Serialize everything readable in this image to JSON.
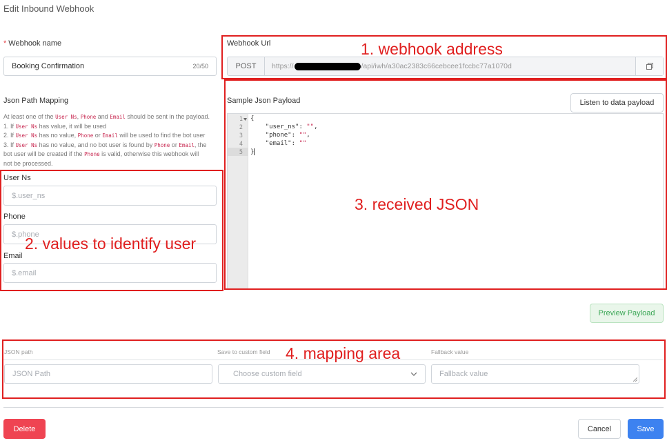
{
  "page": {
    "title": "Edit Inbound Webhook"
  },
  "webhook_name": {
    "label": "Webhook name",
    "required_mark": "*",
    "value": "Booking Confirmation",
    "counter": "20/50"
  },
  "webhook_url": {
    "label": "Webhook Url",
    "method": "POST",
    "url_prefix": "https://",
    "url_suffix": "/api/iwh/a30ac2383c66cebcee1fccbc77a1070d",
    "copy_icon": "copy-icon"
  },
  "json_path_mapping": {
    "title": "Json Path Mapping",
    "help": {
      "intro_a": "At least one of the ",
      "intro_c1": "User Ns",
      "intro_b": ", ",
      "intro_c2": "Phone",
      "intro_d": " and ",
      "intro_c3": "Email",
      "intro_e": " should be sent in the payload.",
      "l1_a": "1. If ",
      "l1_c": "User Ns",
      "l1_b": " has value, it will be used",
      "l2_a": "2. If ",
      "l2_c1": "User Ns",
      "l2_b": " has no value, ",
      "l2_c2": "Phone",
      "l2_d": " or ",
      "l2_c3": "Email",
      "l2_e": " will be used to find the bot user",
      "l3_a": "3. If ",
      "l3_c1": "User Ns",
      "l3_b": " has no value, and no bot user is found by ",
      "l3_c2": "Phone",
      "l3_d": " or ",
      "l3_c3": "Email",
      "l3_e": ", the",
      "l4_a": "bot user will be created if the ",
      "l4_c": "Phone",
      "l4_b": " is valid, otherwise this webhook will",
      "l5": "not be processed."
    },
    "user_ns": {
      "label": "User Ns",
      "placeholder": "$.user_ns"
    },
    "phone": {
      "label": "Phone",
      "placeholder": "$.phone"
    },
    "email": {
      "label": "Email",
      "placeholder": "$.email"
    }
  },
  "sample_payload": {
    "label": "Sample Json Payload",
    "listen_button": "Listen to data payload",
    "line_numbers": [
      "1",
      "2",
      "3",
      "4",
      "5"
    ],
    "lines": [
      {
        "pre": "{",
        "val": ""
      },
      {
        "pre": "    \"user_ns\": ",
        "val": "\"\"",
        "post": ","
      },
      {
        "pre": "    \"phone\": ",
        "val": "\"\"",
        "post": ","
      },
      {
        "pre": "    \"email\": ",
        "val": "\"\"",
        "post": ""
      },
      {
        "pre": "}",
        "val": ""
      }
    ]
  },
  "preview_button": "Preview Payload",
  "mapping": {
    "col_json_path": "JSON path",
    "col_custom_field": "Save to custom field",
    "col_fallback": "Fallback value",
    "json_path_placeholder": "JSON Path",
    "custom_field_placeholder": "Choose custom field",
    "fallback_placeholder": "Fallback value"
  },
  "footer": {
    "delete": "Delete",
    "cancel": "Cancel",
    "save": "Save"
  },
  "annotations": {
    "a1": "1. webhook address",
    "a2": "2. values to identify user",
    "a3": "3. received JSON",
    "a4": "4. mapping area"
  },
  "colors": {
    "annotation": "#e01f1f",
    "delete": "#ef4452",
    "save": "#3d82f0",
    "preview_bg": "#e9f6ea",
    "preview_text": "#3aa655"
  }
}
